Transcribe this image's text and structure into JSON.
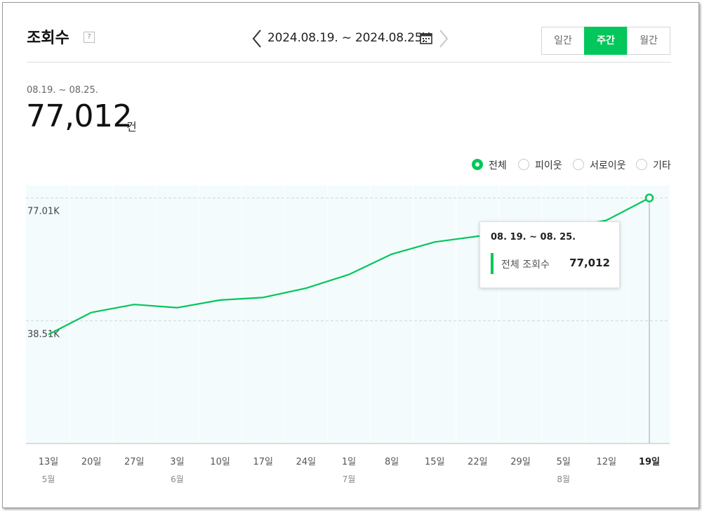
{
  "header": {
    "title": "조회수",
    "help_glyph": "?",
    "date_range": "2024.08.19. ~ 2024.08.25.",
    "period_options": [
      "일간",
      "주간",
      "월간"
    ],
    "active_period": "주간"
  },
  "summary": {
    "range": "08.19. ~ 08.25.",
    "value": "77,012",
    "unit": "건"
  },
  "filters": {
    "options": [
      "전체",
      "피이웃",
      "서로이웃",
      "기타"
    ],
    "selected": "전체"
  },
  "tooltip": {
    "range": "08. 19. ~ 08. 25.",
    "label": "전체 조회수",
    "value": "77,012"
  },
  "colors": {
    "accent": "#03c75a",
    "plot_bg": "#f4fbfc",
    "grid": "#dfe6e8"
  },
  "chart_data": {
    "type": "line",
    "x": [
      "13일",
      "20일",
      "27일",
      "3일",
      "10일",
      "17일",
      "24일",
      "1일",
      "8일",
      "15일",
      "22일",
      "29일",
      "5일",
      "12일",
      "19일"
    ],
    "month_labels": [
      {
        "at": "13일",
        "label": "5월"
      },
      {
        "at": "3일",
        "label": "6월"
      },
      {
        "at": "1일",
        "label": "7월"
      },
      {
        "at": "5일",
        "label": "8월"
      }
    ],
    "highlighted_x": "19일",
    "series": [
      {
        "values": [
          34200,
          41100,
          43600,
          42600,
          45000,
          45800,
          48700,
          53000,
          59400,
          63200,
          65000,
          66300,
          67400,
          70000,
          77012
        ]
      }
    ],
    "y_ticks": [
      {
        "value": 38506,
        "label": "38.51K"
      },
      {
        "value": 77012,
        "label": "77.01K"
      }
    ],
    "ylim": [
      0,
      80900
    ],
    "grid": "dashed horizontal",
    "legend": "top-right radio filters"
  }
}
